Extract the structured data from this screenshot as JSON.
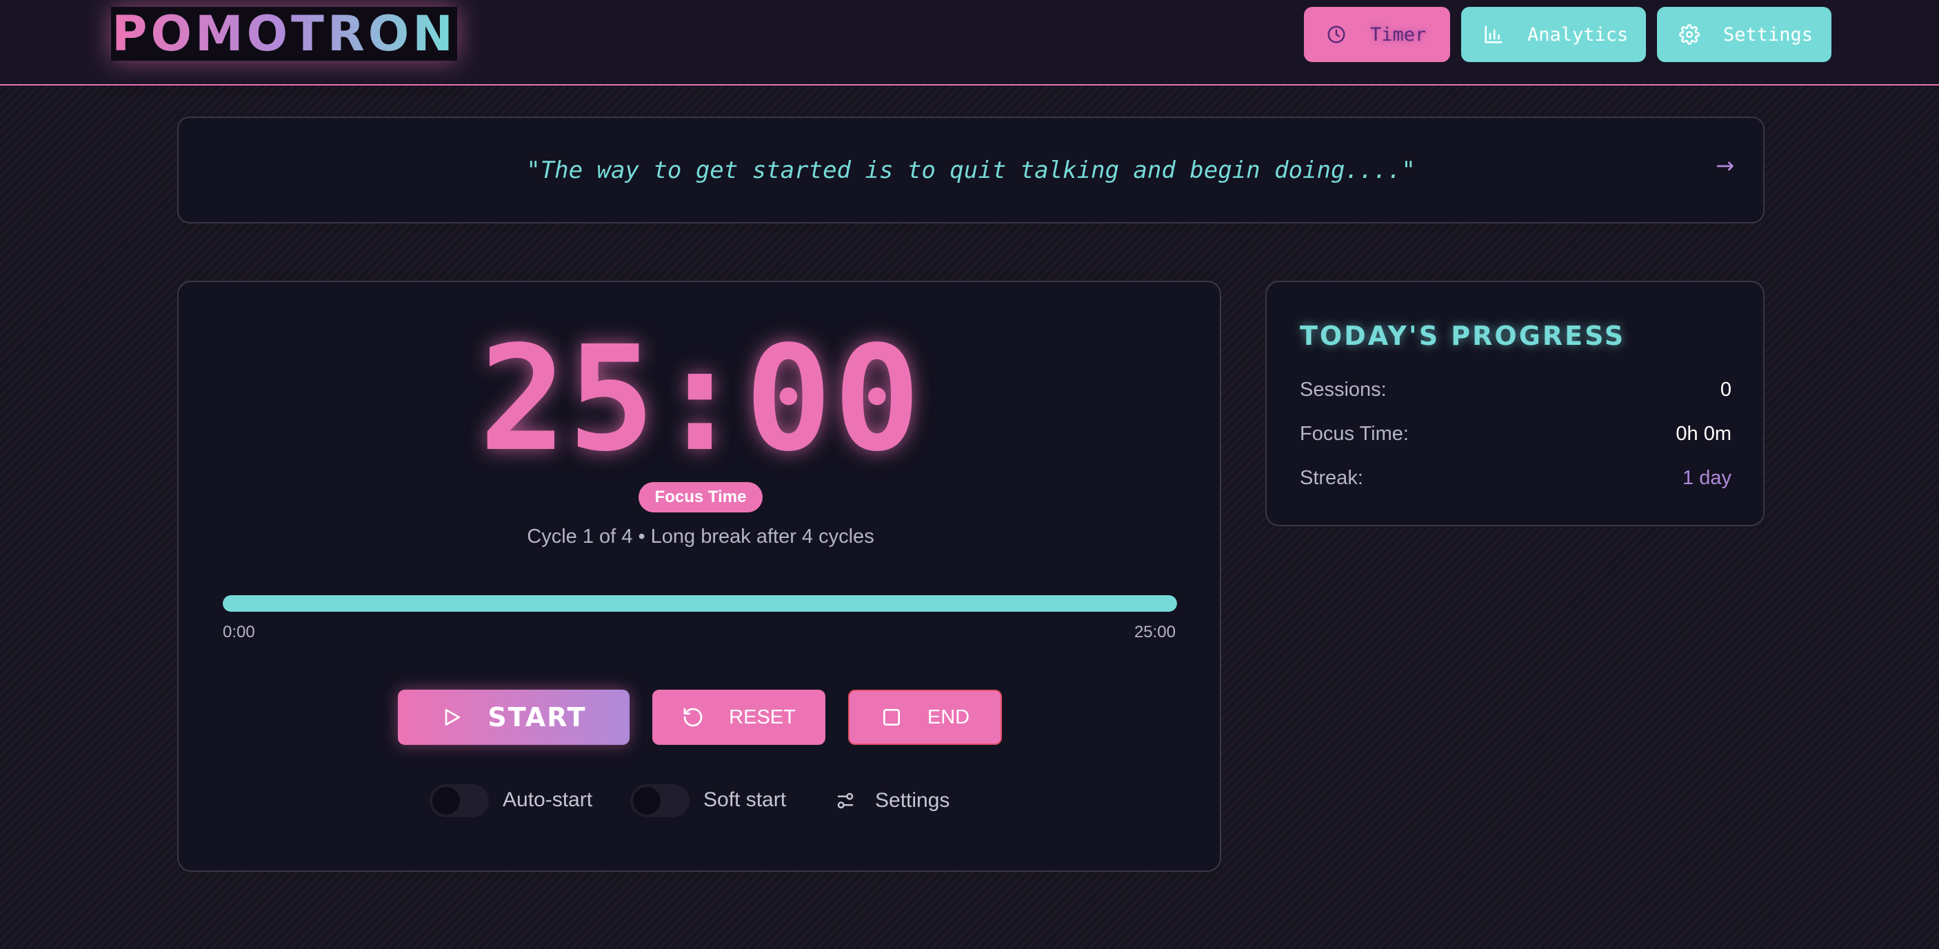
{
  "app": {
    "logo": "POMOTRON"
  },
  "nav": {
    "timer": "Timer",
    "analytics": "Analytics",
    "settings": "Settings"
  },
  "quote": {
    "text": "\"The way to get started is to quit talking and begin doing....\"",
    "next_arrow": "→"
  },
  "timer": {
    "display": "25:00",
    "mode_badge": "Focus Time",
    "cycle_text": "Cycle 1 of 4 • Long break after 4 cycles",
    "progress": {
      "value": 1.0,
      "start_label": "0:00",
      "end_label": "25:00"
    },
    "buttons": {
      "start": "START",
      "reset": "RESET",
      "end": "END"
    },
    "toggles": {
      "auto_start": {
        "label": "Auto-start",
        "on": false
      },
      "soft_start": {
        "label": "Soft start",
        "on": false
      }
    },
    "settings_link": "Settings"
  },
  "progress_card": {
    "title": "TODAY'S PROGRESS",
    "rows": [
      {
        "label": "Sessions:",
        "value": "0"
      },
      {
        "label": "Focus Time:",
        "value": "0h 0m"
      },
      {
        "label": "Streak:",
        "value": "1 day"
      }
    ]
  },
  "colors": {
    "background": "#17141f",
    "pink": "#ec74b5",
    "cyan": "#76dbd8",
    "purple": "#b08ad9",
    "card": "#131220"
  },
  "icons": {
    "timer_nav": "clock-icon",
    "analytics_nav": "bar-chart-icon",
    "settings_nav": "gear-icon",
    "start": "play-icon",
    "reset": "reset-icon",
    "end": "stop-icon",
    "settings_link": "sliders-icon"
  }
}
